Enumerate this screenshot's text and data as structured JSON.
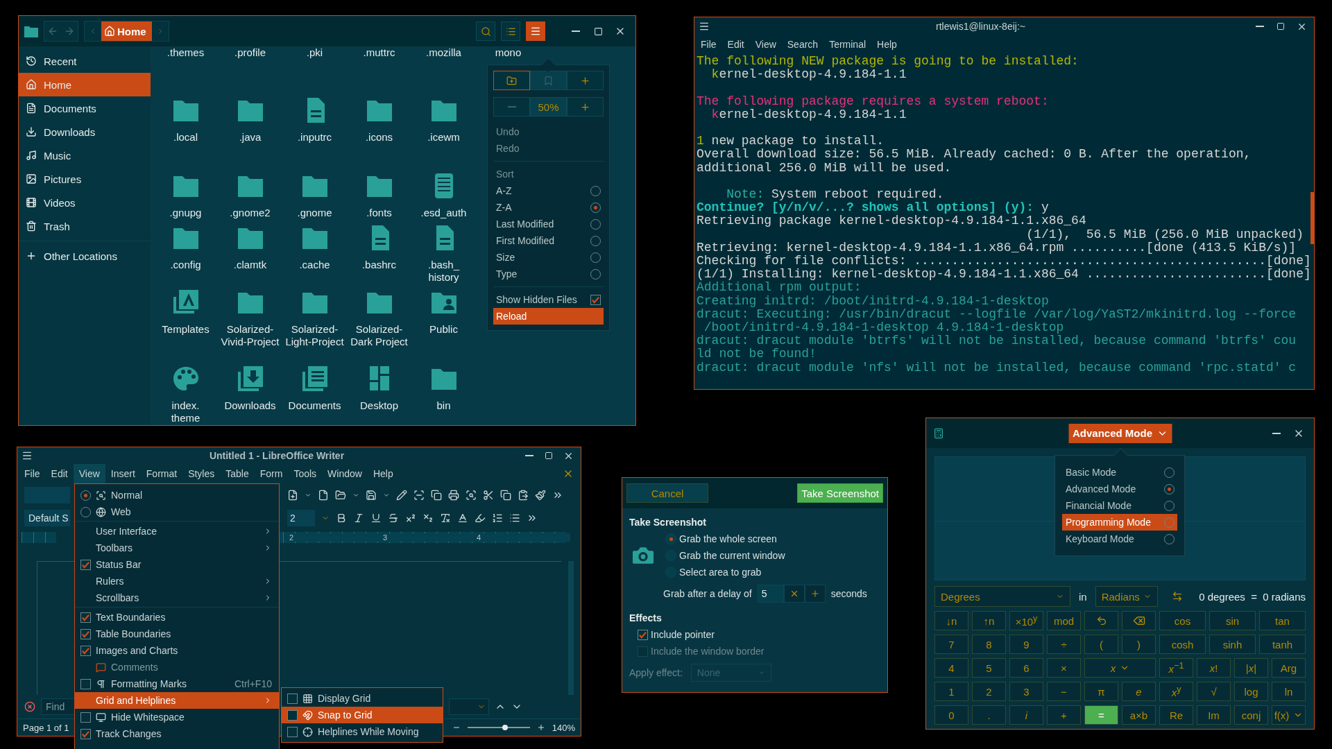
{
  "file_manager": {
    "location": "Home",
    "sidebar": [
      {
        "label": "Recent",
        "selected": false
      },
      {
        "label": "Home",
        "selected": true
      },
      {
        "label": "Documents",
        "selected": false
      },
      {
        "label": "Downloads",
        "selected": false
      },
      {
        "label": "Music",
        "selected": false
      },
      {
        "label": "Pictures",
        "selected": false
      },
      {
        "label": "Videos",
        "selected": false
      },
      {
        "label": "Trash",
        "selected": false
      }
    ],
    "other_locations": "Other Locations",
    "file_rows": [
      [
        {
          "name": ".themes",
          "kind": "scrolled"
        },
        {
          "name": ".profile",
          "kind": "scrolled"
        },
        {
          "name": ".pki",
          "kind": "scrolled"
        },
        {
          "name": ".muttrc",
          "kind": "scrolled"
        },
        {
          "name": ".mozilla",
          "kind": "scrolled"
        },
        {
          "name": "mono",
          "kind": "scrolled"
        }
      ],
      [
        {
          "name": ".local",
          "kind": "folder"
        },
        {
          "name": ".java",
          "kind": "folder"
        },
        {
          "name": ".inputrc",
          "kind": "document"
        },
        {
          "name": ".icons",
          "kind": "folder"
        },
        {
          "name": ".icewm",
          "kind": "folder"
        }
      ],
      [
        {
          "name": ".gnupg",
          "kind": "folder"
        },
        {
          "name": ".gnome2",
          "kind": "folder"
        },
        {
          "name": ".gnome",
          "kind": "folder"
        },
        {
          "name": ".fonts",
          "kind": "folder"
        },
        {
          "name": ".esd_auth",
          "kind": "binary"
        }
      ],
      [
        {
          "name": ".config",
          "kind": "folder"
        },
        {
          "name": ".clamtk",
          "kind": "folder"
        },
        {
          "name": ".cache",
          "kind": "folder"
        },
        {
          "name": ".bashrc",
          "kind": "document"
        },
        {
          "name": ".bash_\nhistory",
          "kind": "document"
        }
      ],
      [
        {
          "name": "Templates",
          "kind": "templates"
        },
        {
          "name": "Solarized-Vivid-Project",
          "kind": "folder"
        },
        {
          "name": "Solarized-Light-Project",
          "kind": "folder"
        },
        {
          "name": "Solarized-Dark Project",
          "kind": "folder"
        },
        {
          "name": "Public",
          "kind": "public"
        }
      ],
      [
        {
          "name": "index.\ntheme",
          "kind": "palette"
        },
        {
          "name": "Downloads",
          "kind": "downloads"
        },
        {
          "name": "Documents",
          "kind": "documents"
        },
        {
          "name": "Desktop",
          "kind": "desktop"
        },
        {
          "name": "bin",
          "kind": "folder"
        }
      ]
    ],
    "menu": {
      "view_buttons": [
        {
          "focused": true,
          "disabled": false
        },
        {
          "focused": false,
          "disabled": true
        },
        {
          "focused": false,
          "disabled": false
        }
      ],
      "zoom": "50%",
      "zoom_out_disabled": true,
      "edit_items": [
        {
          "label": "Undo",
          "disabled": true
        },
        {
          "label": "Redo",
          "disabled": true
        }
      ],
      "sort_title": "Sort",
      "sort_options": [
        {
          "label": "A-Z",
          "selected": false
        },
        {
          "label": "Z-A",
          "selected": true
        },
        {
          "label": "Last Modified",
          "selected": false
        },
        {
          "label": "First Modified",
          "selected": false
        },
        {
          "label": "Size",
          "selected": false
        },
        {
          "label": "Type",
          "selected": false
        }
      ],
      "hidden_files": {
        "label": "Show Hidden Files",
        "checked": true
      },
      "reload": "Reload"
    }
  },
  "terminal": {
    "title": "rtlewis1@linux-8eij:~",
    "menus": [
      "File",
      "Edit",
      "View",
      "Search",
      "Terminal",
      "Help"
    ],
    "blocks": [
      [
        [
          {
            "text": "The following NEW package is going to be installed:",
            "color": "#b3b800"
          }
        ],
        [
          {
            "text": "  k",
            "color": "#b3b800"
          },
          {
            "text": "ernel-desktop-4.9.184-1.1",
            "color": "#d6d6d6"
          }
        ]
      ],
      [
        [
          {
            "text": "The following package requires a system reboot:",
            "color": "#e8307c"
          }
        ],
        [
          {
            "text": "  k",
            "color": "#e8307c"
          },
          {
            "text": "ernel-desktop-4.9.184-1.1",
            "color": "#d6d6d6"
          }
        ]
      ],
      [
        [
          {
            "text": "1",
            "color": "#b3b800"
          },
          {
            "text": " new package to install.",
            "color": "#d6d6d6"
          }
        ],
        [
          {
            "text": "Overall download size: 56.5 MiB. Already cached: 0 B. After the operation,",
            "color": "#d6d6d6"
          }
        ],
        [
          {
            "text": "additional 256.0 MiB will be used.",
            "color": "#d6d6d6"
          }
        ]
      ],
      [
        [
          {
            "text": "    Note:",
            "color": "#2ab0a0"
          },
          {
            "text": " System reboot required.",
            "color": "#d6d6d6"
          }
        ],
        [
          {
            "text": "**Continue? [y/n/v/...? shows all options] (y):**",
            "color": "#22c4b8"
          },
          {
            "text": " y",
            "color": "#d6d6d6"
          }
        ],
        [
          {
            "text": "Retrieving package kernel-desktop-4.9.184-1.1.x86_64",
            "color": "#d6d6d6"
          }
        ],
        [
          {
            "text": "                                            (1/1),  56.5 MiB (256.0 MiB unpacked)",
            "color": "#d6d6d6"
          }
        ],
        [
          {
            "text": "Retrieving: kernel-desktop-4.9.184-1.1.x86_64.rpm ..........[done (413.5 KiB/s)]",
            "color": "#d6d6d6"
          }
        ],
        [
          {
            "text": "Checking for file conflicts: ...............................................[done]",
            "color": "#d6d6d6"
          }
        ],
        [
          {
            "text": "(1/1) Installing: kernel-desktop-4.9.184-1.1.x86_64 ........................[done]",
            "color": "#d6d6d6"
          }
        ],
        [
          {
            "text": "Additional rpm output:",
            "color": "#2aa198"
          }
        ],
        [
          {
            "text": "Creating initrd: /boot/initrd-4.9.184-1-desktop",
            "color": "#2aa198"
          }
        ],
        [
          {
            "text": "dracut: Executing: /usr/bin/dracut --logfile /var/log/YaST2/mkinitrd.log --force",
            "color": "#2aa198"
          }
        ],
        [
          {
            "text": " /boot/initrd-4.9.184-1-desktop 4.9.184-1-desktop",
            "color": "#2aa198"
          }
        ],
        [
          {
            "text": "dracut: dracut module 'btrfs' will not be installed, because command 'btrfs' cou",
            "color": "#2aa198"
          }
        ],
        [
          {
            "text": "ld not be found!",
            "color": "#2aa198"
          }
        ],
        [
          {
            "text": "dracut: dracut module 'nfs' will not be installed, because command 'rpc.statd' c",
            "color": "#2aa198"
          }
        ]
      ]
    ]
  },
  "writer": {
    "title": "Untitled 1 - LibreOffice Writer",
    "menus": [
      {
        "label": "File",
        "selected": false
      },
      {
        "label": "Edit",
        "selected": false
      },
      {
        "label": "View",
        "selected": true
      },
      {
        "label": "Insert",
        "selected": false
      },
      {
        "label": "Format",
        "selected": false
      },
      {
        "label": "Styles",
        "selected": false
      },
      {
        "label": "Table",
        "selected": false
      },
      {
        "label": "Form",
        "selected": false
      },
      {
        "label": "Tools",
        "selected": false
      },
      {
        "label": "Window",
        "selected": false
      },
      {
        "label": "Help",
        "selected": false
      }
    ],
    "style_box": "Default S",
    "font_size": "2",
    "ruler_marks": [
      "2",
      "3",
      "4"
    ],
    "find": {
      "placeholder": "Find"
    },
    "status": {
      "page": "Page 1 of 1",
      "zoom": "140%",
      "zoom_slider": {
        "level": 0.6
      }
    },
    "view_menu": [
      [
        {
          "label": "Normal",
          "kind": "radio",
          "selected": true,
          "highlighted": false
        },
        {
          "label": "Web",
          "kind": "radio",
          "selected": false,
          "highlighted": false
        }
      ],
      [
        {
          "label": "User Interface",
          "kind": "submenu",
          "highlighted": false
        },
        {
          "label": "Toolbars",
          "kind": "submenu",
          "highlighted": false
        },
        {
          "label": "Status Bar",
          "kind": "check",
          "checked": true,
          "highlighted": false
        },
        {
          "label": "Rulers",
          "kind": "submenu",
          "highlighted": false
        },
        {
          "label": "Scrollbars",
          "kind": "submenu",
          "highlighted": false
        }
      ],
      [
        {
          "label": "Text Boundaries",
          "kind": "check",
          "checked": true,
          "highlighted": false
        },
        {
          "label": "Table Boundaries",
          "kind": "check",
          "checked": true,
          "highlighted": false
        },
        {
          "label": "Images and Charts",
          "kind": "check",
          "checked": true,
          "highlighted": false
        },
        {
          "label": "Comments",
          "kind": "command",
          "highlighted": false
        },
        {
          "label": "Formatting Marks",
          "kind": "check",
          "checked": false,
          "highlighted": false,
          "shortcut": "Ctrl+F10"
        },
        {
          "label": "Grid and Helplines",
          "kind": "submenu",
          "highlighted": true
        },
        {
          "label": "Hide Whitespace",
          "kind": "check",
          "checked": false,
          "highlighted": false
        },
        {
          "label": "Track Changes",
          "kind": "check",
          "checked": true,
          "highlighted": false
        }
      ]
    ],
    "grid_submenu": [
      {
        "label": "Display Grid",
        "checked": false,
        "highlighted": false
      },
      {
        "label": "Snap to Grid",
        "checked": false,
        "highlighted": true
      },
      {
        "label": "Helplines While Moving",
        "checked": false,
        "highlighted": false
      }
    ]
  },
  "screenshot": {
    "cancel": "Cancel",
    "take": "Take Screenshot",
    "section": "Take Screenshot",
    "grab_options": [
      {
        "label": "Grab the whole screen",
        "selected": true
      },
      {
        "label": "Grab the current window",
        "selected": false
      },
      {
        "label": "Select area to grab",
        "selected": false
      }
    ],
    "delay_label": "Grab after a delay of",
    "delay_value": "5",
    "delay_unit": "seconds",
    "effects_title": "Effects",
    "effects": [
      {
        "label": "Include pointer",
        "checked": true,
        "disabled": false
      },
      {
        "label": "Include the window border",
        "checked": false,
        "disabled": true
      }
    ],
    "apply_label": "Apply effect:",
    "apply_value": "None"
  },
  "calculator": {
    "mode_button": "Advanced Mode",
    "modes": [
      {
        "label": "Basic Mode",
        "selected": false,
        "highlighted": false
      },
      {
        "label": "Advanced Mode",
        "selected": true,
        "highlighted": false
      },
      {
        "label": "Financial Mode",
        "selected": false,
        "highlighted": false
      },
      {
        "label": "Programming Mode",
        "selected": false,
        "highlighted": true
      },
      {
        "label": "Keyboard Mode",
        "selected": false,
        "highlighted": false
      }
    ],
    "converter": {
      "from": "Degrees",
      "in": "in",
      "to": "Radians",
      "result": "0 degrees  =  0 radians"
    },
    "keypad": [
      {
        "left": [
          {
            "kind": "text",
            "label": "↓n"
          },
          {
            "kind": "text",
            "label": "↑n"
          },
          {
            "kind": "text",
            "label": "×10$^{y}$"
          },
          {
            "kind": "text",
            "label": "mod"
          },
          {
            "kind": "undo"
          },
          {
            "kind": "backspace"
          }
        ],
        "right": [
          {
            "kind": "text",
            "label": "cos"
          },
          {
            "kind": "text",
            "label": "sin"
          },
          {
            "kind": "text",
            "label": "tan"
          }
        ]
      },
      {
        "left": [
          {
            "kind": "text",
            "label": "7"
          },
          {
            "kind": "text",
            "label": "8"
          },
          {
            "kind": "text",
            "label": "9"
          },
          {
            "kind": "text",
            "label": "÷"
          },
          {
            "kind": "text",
            "label": "("
          },
          {
            "kind": "text",
            "label": ")"
          }
        ],
        "right": [
          {
            "kind": "text",
            "label": "cosh"
          },
          {
            "kind": "text",
            "label": "sinh"
          },
          {
            "kind": "text",
            "label": "tanh"
          }
        ]
      },
      {
        "left": [
          {
            "kind": "text",
            "label": "4"
          },
          {
            "kind": "text",
            "label": "5"
          },
          {
            "kind": "text",
            "label": "6"
          },
          {
            "kind": "text",
            "label": "×"
          },
          {
            "kind": "menu",
            "label": "*x*"
          }
        ],
        "right": [
          {
            "kind": "text",
            "label": "*x*$^{−1}$"
          },
          {
            "kind": "text",
            "label": "*x*!"
          },
          {
            "kind": "text",
            "label": "|*x*|"
          },
          {
            "kind": "text",
            "label": "Arg"
          }
        ]
      },
      {
        "left": [
          {
            "kind": "text",
            "label": "1"
          },
          {
            "kind": "text",
            "label": "2"
          },
          {
            "kind": "text",
            "label": "3"
          },
          {
            "kind": "text",
            "label": "−"
          },
          {
            "kind": "text",
            "label": "π"
          },
          {
            "kind": "text",
            "label": "*e*"
          }
        ],
        "right": [
          {
            "kind": "text",
            "label": "*x*$^{y}$"
          },
          {
            "kind": "text",
            "label": "√"
          },
          {
            "kind": "text",
            "label": "log"
          },
          {
            "kind": "text",
            "label": "ln"
          }
        ]
      },
      {
        "left": [
          {
            "kind": "text",
            "label": "0"
          },
          {
            "kind": "text",
            "label": "."
          },
          {
            "kind": "text",
            "label": "*i*"
          },
          {
            "kind": "text",
            "label": "+"
          },
          {
            "kind": "equals",
            "label": "="
          },
          {
            "kind": "text",
            "label": "a×b"
          }
        ],
        "right": [
          {
            "kind": "text",
            "label": "Re"
          },
          {
            "kind": "text",
            "label": "Im"
          },
          {
            "kind": "text",
            "label": "conj"
          },
          {
            "kind": "menu",
            "label": "f(x)"
          }
        ]
      }
    ]
  }
}
